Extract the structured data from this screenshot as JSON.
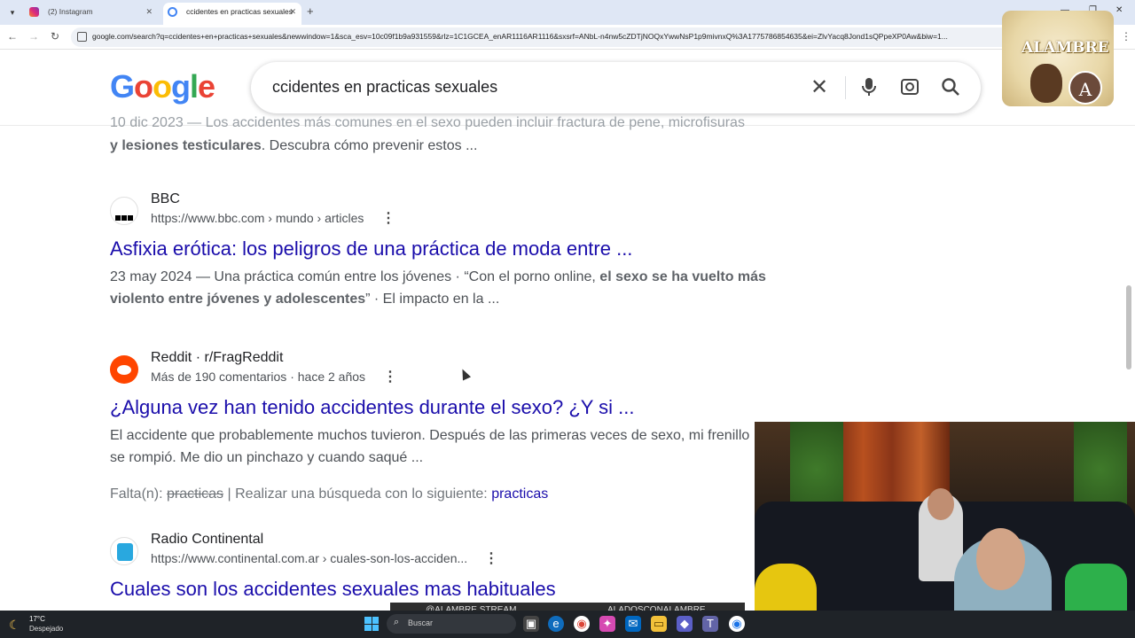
{
  "browser": {
    "tabs": [
      {
        "label": "(2) Instagram"
      },
      {
        "label": "ccidentes en practicas sexuales"
      }
    ],
    "url": "google.com/search?q=ccidentes+en+practicas+sexuales&newwindow=1&sca_esv=10c09f1b9a931559&rlz=1C1GCEA_enAR1116AR1116&sxsrf=ANbL-n4nw5cZDTjNOQxYwwNsP1p9mivnxQ%3A1775786854635&ei=ZlvYacq8Jond1sQPpeXP0Aw&biw=1..."
  },
  "google": {
    "logo": [
      "G",
      "o",
      "o",
      "g",
      "l",
      "e"
    ],
    "query": "ccidentes en practicas sexuales"
  },
  "overlay": {
    "brand": "ALAMBRE",
    "avatar_initial": "A"
  },
  "results": {
    "top_snippet_line1": "10 dic 2023 — Los accidentes más comunes en el sexo pueden incluir fractura de pene, microfisuras",
    "top_snippet_bold": "y lesiones testiculares",
    "top_snippet_rest": ". Descubra cómo prevenir estos ...",
    "items": [
      {
        "site": "BBC",
        "cite": "https://www.bbc.com › mundo › articles",
        "title": "Asfixia erótica: los peligros de una práctica de moda entre ...",
        "snippet_a": "23 may 2024 — Una práctica común entre los jóvenes · “Con el porno online, ",
        "snippet_bold": "el sexo se ha vuelto más violento entre jóvenes y adolescentes",
        "snippet_b": "” · El impacto en la ..."
      },
      {
        "site": "Reddit · r/FragReddit",
        "cite": "Más de 190 comentarios · hace 2 años",
        "title": "¿Alguna vez han tenido accidentes durante el sexo? ¿Y si ...",
        "snippet": "El accidente que probablemente muchos tuvieron. Después de las primeras veces de sexo, mi frenillo se rompió. Me dio un pinchazo y cuando saqué ...",
        "missing_label": "Falta(n):",
        "missing_term": "practicas",
        "missing_sep": " | Realizar una búsqueda con lo siguiente: ",
        "missing_link": "practicas"
      },
      {
        "site": "Radio Continental",
        "cite": "https://www.continental.com.ar › cuales-son-los-acciden...",
        "title": "Cuales son los accidentes sexuales mas habituales"
      }
    ]
  },
  "stream_banner": {
    "left": "@ALAMBRE.STREAM",
    "right": "ALADOSCONALAMBRE"
  },
  "taskbar": {
    "temperature": "17°C",
    "condition": "Despejado",
    "search_label": "Buscar"
  },
  "colors": {
    "link": "#1a0dab",
    "snippet": "#4d5156",
    "taskbar": "#1f2328"
  }
}
